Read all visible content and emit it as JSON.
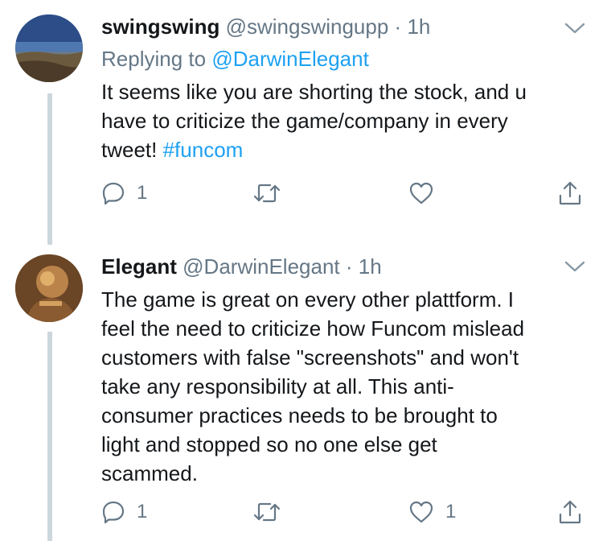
{
  "tweets": [
    {
      "display_name": "swingswing",
      "handle": "@swingswingupp",
      "separator": "·",
      "time": "1h",
      "replying_prefix": "Replying to ",
      "replying_to": "@DarwinElegant",
      "text_lines": [
        "It seems like you are shorting the stock, and u",
        "have to criticize the game/company in every"
      ],
      "text_last_plain": "tweet! ",
      "hashtag": "#funcom",
      "reply_count": "1",
      "like_count": ""
    },
    {
      "display_name": "Elegant",
      "handle": "@DarwinElegant",
      "separator": "·",
      "time": "1h",
      "text_lines": [
        "The game is great on every other plattform. I",
        "feel the need to criticize how Funcom mislead",
        "customers with false \"screenshots\" and won't",
        "take any responsibility at all. This anti-",
        "consumer practices needs to be brought to",
        "light and stopped so no one else get",
        "scammed."
      ],
      "reply_count": "1",
      "like_count": "1"
    }
  ],
  "icons": {
    "menu": "chevron-down-icon",
    "reply": "reply-icon",
    "retweet": "retweet-icon",
    "like": "like-icon",
    "share": "share-icon"
  },
  "colors": {
    "text": "#14171a",
    "secondary": "#657786",
    "link": "#1da1f2",
    "thread_line": "#ccd6dd"
  }
}
